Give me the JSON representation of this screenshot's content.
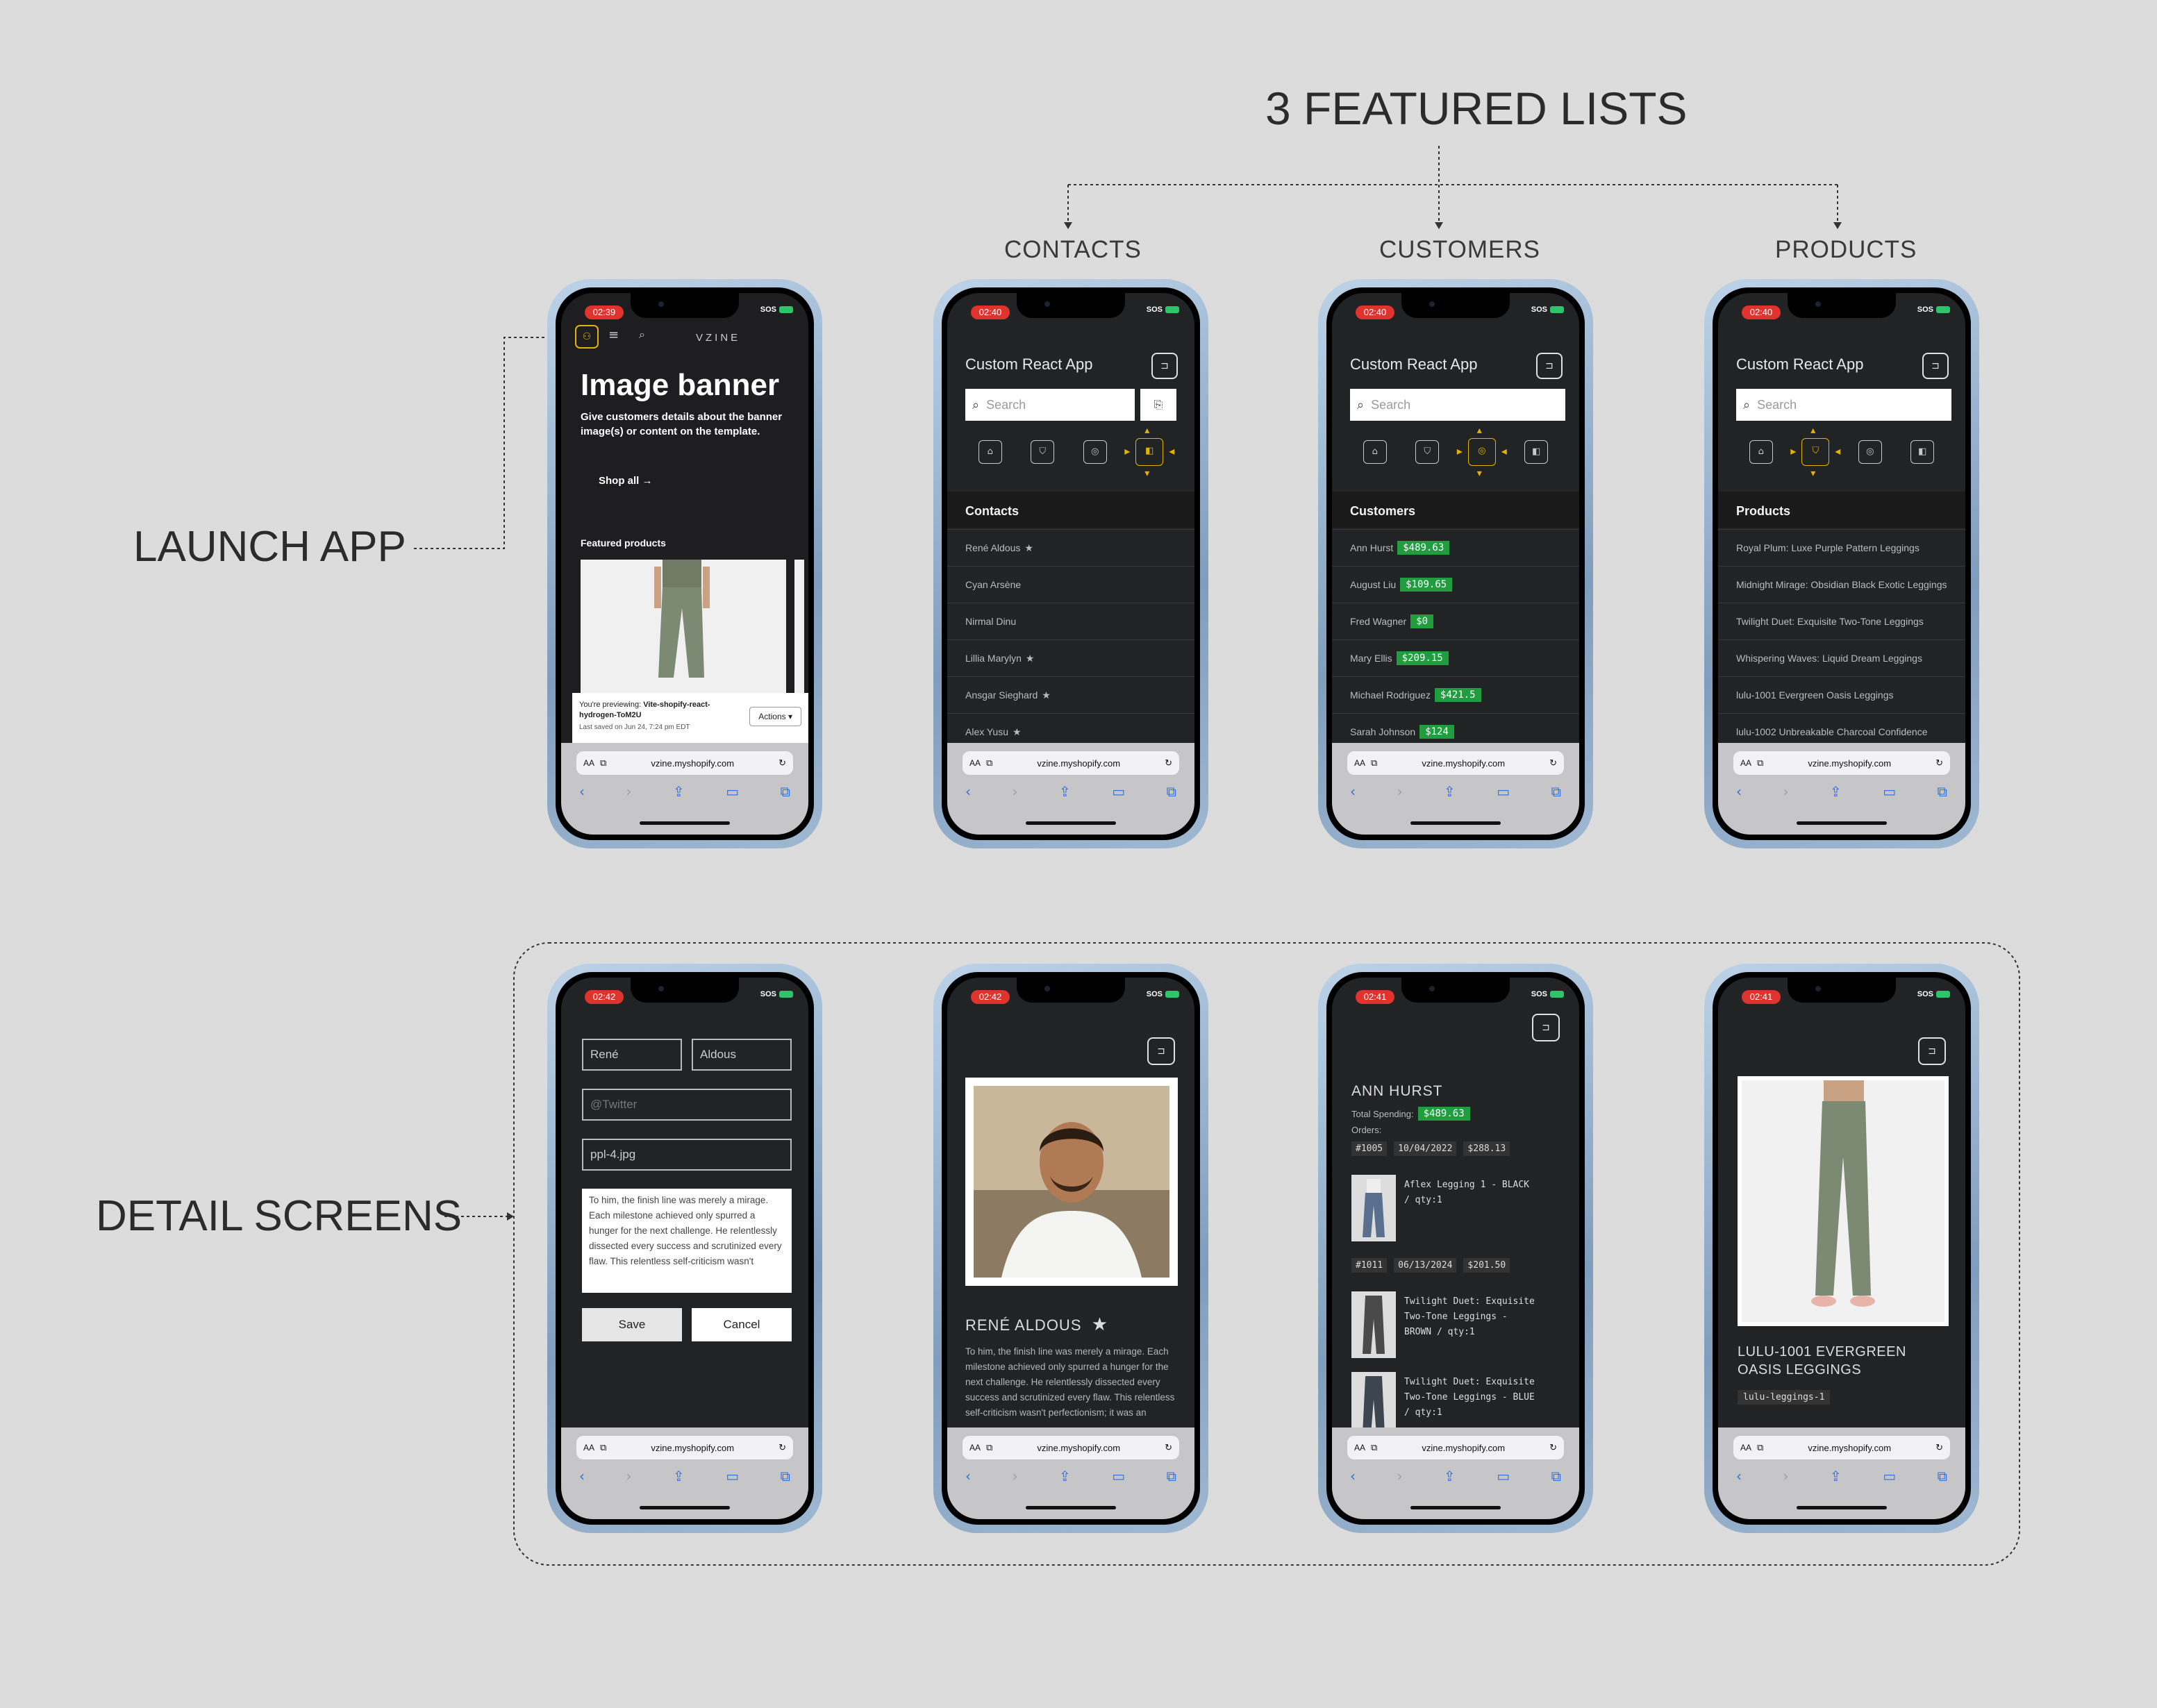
{
  "headings": {
    "featured": "3 FEATURED LISTS",
    "contacts": "CONTACTS",
    "customers": "CUSTOMERS",
    "products": "PRODUCTS",
    "launch": "LAUNCH APP",
    "detail": "DETAIL SCREENS"
  },
  "common": {
    "sos": "SOS",
    "url": "vzine.myshopify.com",
    "aa": "AA",
    "app_title": "Custom React App",
    "search_placeholder": "Search"
  },
  "times": {
    "launch": "02:39",
    "contacts": "02:40",
    "customers": "02:40",
    "products": "02:40",
    "contact_form": "02:42",
    "contact_detail": "02:42",
    "customer_detail": "02:41",
    "product_detail": "02:41"
  },
  "launch": {
    "brand": "VZINE",
    "banner_title": "Image banner",
    "banner_text": "Give customers details about the banner image(s) or content on the template.",
    "shop_all": "Shop all",
    "featured": "Featured products",
    "preview_prefix": "You're previewing:",
    "preview_name": "Vite-shopify-react-hydrogen-ToM2U",
    "saved": "Last saved on Jun 24, 7:24 pm EDT",
    "actions": "Actions"
  },
  "contacts": {
    "header": "Contacts",
    "items": [
      {
        "name": "René Aldous",
        "star": "★"
      },
      {
        "name": "Cyan Arsène",
        "star": ""
      },
      {
        "name": "Nirmal Dinu",
        "star": ""
      },
      {
        "name": "Lillia Marylyn",
        "star": "★"
      },
      {
        "name": "Ansgar Sieghard",
        "star": "★"
      },
      {
        "name": "Alex Yusu",
        "star": "★"
      }
    ]
  },
  "customers": {
    "header": "Customers",
    "items": [
      {
        "name": "Ann Hurst",
        "amount": "$489.63"
      },
      {
        "name": "August Liu",
        "amount": "$109.65"
      },
      {
        "name": "Fred Wagner",
        "amount": "$0"
      },
      {
        "name": "Mary Ellis",
        "amount": "$209.15"
      },
      {
        "name": "Michael Rodriguez",
        "amount": "$421.5"
      },
      {
        "name": "Sarah Johnson",
        "amount": "$124"
      }
    ]
  },
  "products": {
    "header": "Products",
    "items": [
      "Royal Plum: Luxe Purple Pattern Leggings",
      "Midnight Mirage: Obsidian Black Exotic Leggings",
      "Twilight Duet: Exquisite Two-Tone Leggings",
      "Whispering Waves: Liquid Dream Leggings",
      "lulu-1001 Evergreen Oasis Leggings",
      "lulu-1002 Unbreakable Charcoal Confidence"
    ]
  },
  "contact_form": {
    "first": "René",
    "last": "Aldous",
    "twitter_placeholder": "@Twitter",
    "avatar": "ppl-4.jpg",
    "notes": "To him, the finish line was merely a mirage. Each milestone achieved only spurred a hunger for the next challenge. He relentlessly dissected every success and scrutinized every flaw. This relentless self-criticism wasn't",
    "save": "Save",
    "cancel": "Cancel"
  },
  "contact_detail": {
    "name": "RENÉ ALDOUS",
    "star": "★",
    "bio": "To him, the finish line was merely a mirage. Each milestone achieved only spurred a hunger for the next challenge. He relentlessly dissected every success and scrutinized every flaw. This relentless self-criticism wasn't perfectionism; it was an"
  },
  "customer_detail": {
    "name": "ANN HURST",
    "total_label": "Total Spending:",
    "total": "$489.63",
    "orders_label": "Orders:",
    "orders": [
      {
        "id": "#1005",
        "date": "10/04/2022",
        "amount": "$288.13",
        "line": "Aflex Legging 1 - BLACK / qty:1"
      },
      {
        "id": "#1011",
        "date": "06/13/2024",
        "amount": "$201.50",
        "line": "Twilight Duet: Exquisite Two-Tone Leggings - BROWN / qty:1",
        "line2": "Twilight Duet: Exquisite Two-Tone Leggings - BLUE / qty:1"
      }
    ]
  },
  "product_detail": {
    "title": "LULU-1001 EVERGREEN OASIS LEGGINGS",
    "handle": "lulu-leggings-1"
  },
  "colors": {
    "accent": "#e2b400",
    "money": "#1f9d3f",
    "time": "#e0332e"
  }
}
